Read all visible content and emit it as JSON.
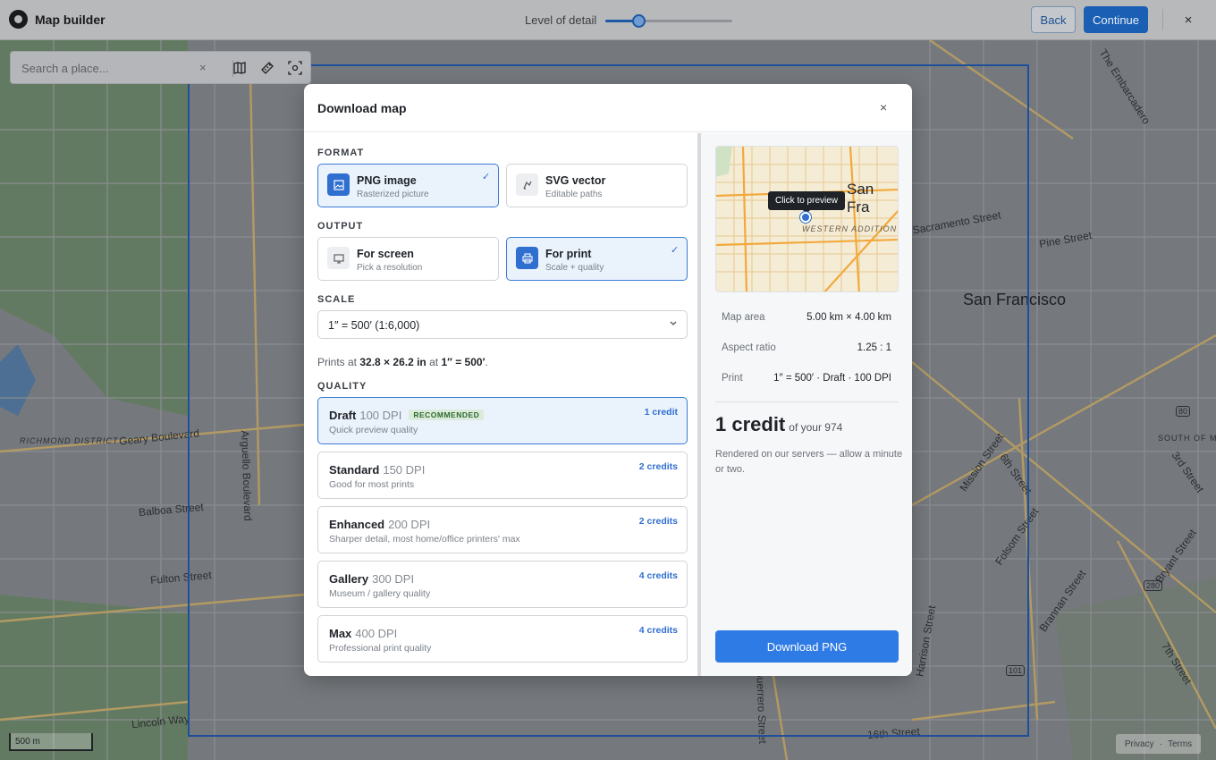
{
  "app": {
    "title": "Map builder"
  },
  "toolbar": {
    "level_of_detail_label": "Level of detail",
    "level_of_detail_value": 0.26,
    "back_label": "Back",
    "continue_label": "Continue",
    "close_symbol": "×"
  },
  "search": {
    "placeholder": "Search a place...",
    "clear_symbol": "×"
  },
  "tools": [
    "map-icon",
    "ruler-icon",
    "select-area-icon"
  ],
  "map": {
    "labels": {
      "richmond": "RICHMOND DISTRICT",
      "geary": "Geary Boulevard",
      "balboa": "Balboa Street",
      "fulton": "Fulton Street",
      "arguello": "Arguello Boulevard",
      "lincoln": "Lincoln Way",
      "sf": "San Francisco",
      "embarcadero": "The Embarcadero",
      "sacramento": "Sacramento Street",
      "pine": "Pine Street",
      "south_market": "SOUTH OF MARKET",
      "mission": "Mission Street",
      "sixth": "6th Street",
      "third": "3rd Street",
      "folsom": "Folsom Street",
      "bryant": "Bryant Street",
      "brannan": "Brannan Street",
      "seventh": "7th Street",
      "harrison": "Harrison Street",
      "guerrero": "Guerrero Street",
      "sixteenth": "16th Street",
      "hwy80": "80",
      "hwy101": "101",
      "hwy280": "280"
    },
    "scale_label": "500 m",
    "privacy": "Privacy",
    "terms": "Terms"
  },
  "modal": {
    "title": "Download map",
    "close_symbol": "×",
    "format_label": "FORMAT",
    "formats": [
      {
        "title": "PNG image",
        "sub": "Rasterized picture",
        "selected": true
      },
      {
        "title": "SVG vector",
        "sub": "Editable paths",
        "selected": false
      }
    ],
    "output_label": "OUTPUT",
    "outputs": [
      {
        "title": "For screen",
        "sub": "Pick a resolution",
        "selected": false
      },
      {
        "title": "For print",
        "sub": "Scale + quality",
        "selected": true
      }
    ],
    "scale_label": "SCALE",
    "scale_value": "1″ = 500′ (1:6,000)",
    "prints_prefix": "Prints at",
    "prints_size": "32.8 × 26.2 in",
    "prints_mid": "at",
    "prints_scale": "1″ = 500′",
    "prints_suffix": ".",
    "quality_label": "QUALITY",
    "qualities": [
      {
        "name": "Draft",
        "dpi": "100 DPI",
        "badge": "RECOMMENDED",
        "desc": "Quick preview quality",
        "credits": "1 credit",
        "selected": true
      },
      {
        "name": "Standard",
        "dpi": "150 DPI",
        "desc": "Good for most prints",
        "credits": "2 credits",
        "selected": false
      },
      {
        "name": "Enhanced",
        "dpi": "200 DPI",
        "desc": "Sharper detail, most home/office printers' max",
        "credits": "2 credits",
        "selected": false
      },
      {
        "name": "Gallery",
        "dpi": "300 DPI",
        "desc": "Museum / gallery quality",
        "credits": "4 credits",
        "selected": false
      },
      {
        "name": "Max",
        "dpi": "400 DPI",
        "desc": "Professional print quality",
        "credits": "4 credits",
        "selected": false
      }
    ],
    "preview": {
      "tooltip": "Click to preview",
      "city": "San Fra",
      "district": "WESTERN ADDITION"
    },
    "stats": [
      {
        "label": "Map area",
        "value": "5.00 km × 4.00 km"
      },
      {
        "label": "Aspect ratio",
        "value": "1.25 : 1"
      },
      {
        "label": "Print",
        "value": "1″ = 500′ · Draft · 100 DPI"
      }
    ],
    "credit_total": "1 credit",
    "credit_of": "of your 974",
    "rendered_note": "Rendered on our servers — allow a minute or two.",
    "download_label": "Download PNG"
  },
  "colors": {
    "accent": "#2f7be5",
    "selected_border": "#3a7bd5",
    "selection_box": "#1e4f9a"
  }
}
